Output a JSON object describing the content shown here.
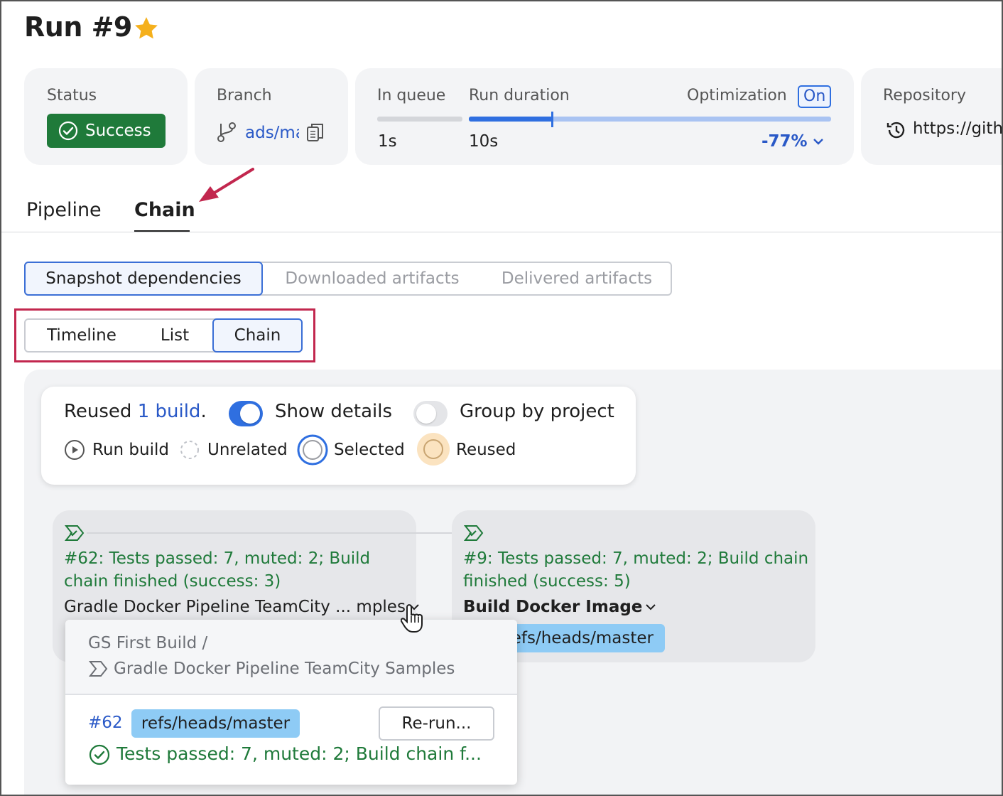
{
  "header": {
    "title": "Run #9",
    "star_icon": "star-icon",
    "star_color": "#f5b01c"
  },
  "status_card": {
    "label": "Status",
    "badge": "Success",
    "badge_color": "#1f7a3a"
  },
  "branch_card": {
    "label": "Branch",
    "value": "ads/ma"
  },
  "queue_card": {
    "in_queue_label": "In queue",
    "in_queue_value": "1s",
    "duration_label": "Run duration",
    "duration_value": "10s",
    "optimization_label": "Optimization",
    "optimization_state": "On",
    "optimization_delta": "-77%"
  },
  "repo_card": {
    "label": "Repository",
    "value": "https://gith"
  },
  "tabs": [
    {
      "label": "Pipeline",
      "active": false
    },
    {
      "label": "Chain",
      "active": true
    }
  ],
  "dependency_tabs": [
    {
      "label": "Snapshot dependencies",
      "selected": true
    },
    {
      "label": "Downloaded artifacts",
      "selected": false
    },
    {
      "label": "Delivered artifacts",
      "selected": false
    }
  ],
  "view_tabs": [
    {
      "label": "Timeline",
      "selected": false
    },
    {
      "label": "List",
      "selected": false
    },
    {
      "label": "Chain",
      "selected": true
    }
  ],
  "legend_panel": {
    "reused_prefix": "Reused",
    "reused_link": "1 build",
    "reused_suffix": ".",
    "show_details": {
      "label": "Show details",
      "on": true
    },
    "group_by_project": {
      "label": "Group by project",
      "on": false
    },
    "legend": [
      {
        "label": "Run build",
        "icon": "play-circle-icon"
      },
      {
        "label": "Unrelated",
        "icon": "dashed-circle-icon"
      },
      {
        "label": "Selected",
        "icon": "selected-circle-icon"
      },
      {
        "label": "Reused",
        "icon": "reused-circle-icon"
      }
    ]
  },
  "nodes": [
    {
      "status_line1": "#62: Tests passed: 7, muted: 2; Build",
      "status_line2": "chain finished (success: 3)",
      "name": "Gradle Docker Pipeline TeamCity ... mples"
    },
    {
      "status_line1": "#9: Tests passed: 7, muted: 2; Build chain",
      "status_line2": "finished (success: 5)",
      "name": "Build Docker Image",
      "branch": "refs/heads/master",
      "branch_visible": "efs/heads/master"
    }
  ],
  "popup": {
    "project_path": "GS First Build /",
    "build_config": "Gradle Docker Pipeline TeamCity Samples",
    "build_number": "#62",
    "branch": "refs/heads/master",
    "rerun_label": "Re-run...",
    "status": "Tests passed: 7, muted: 2; Build chain f..."
  }
}
